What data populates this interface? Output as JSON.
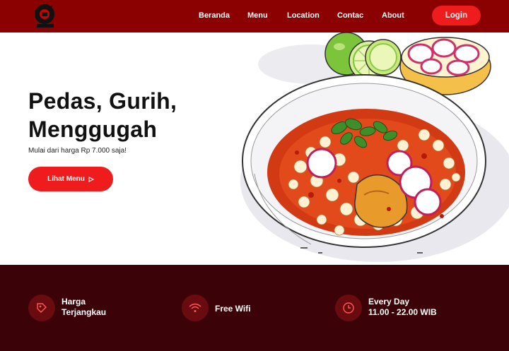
{
  "brand": {
    "logo_icon": "restaurant-logo"
  },
  "nav": {
    "items": [
      {
        "label": "Beranda"
      },
      {
        "label": "Menu"
      },
      {
        "label": "Location"
      },
      {
        "label": "Contac"
      },
      {
        "label": "About"
      }
    ],
    "login_label": "Login"
  },
  "hero": {
    "title": "Pedas, Gurih, Menggugah",
    "subtitle": "Mulai dari harga Rp 7.000 saja!",
    "cta_label": "Lihat Menu",
    "cta_icon": "play-triangle-icon"
  },
  "features": [
    {
      "icon": "price-tag-icon",
      "line1": "Harga",
      "line2": "Terjangkau"
    },
    {
      "icon": "wifi-icon",
      "line1": "Free Wifi",
      "line2": ""
    },
    {
      "icon": "clock-icon",
      "line1": "Every Day",
      "line2": "11.00 - 22.00 WIB"
    }
  ],
  "colors": {
    "navbar": "#8b0000",
    "accent": "#ee1c1c",
    "footer": "#3b0207",
    "icon_circle": "#6a0b10"
  }
}
